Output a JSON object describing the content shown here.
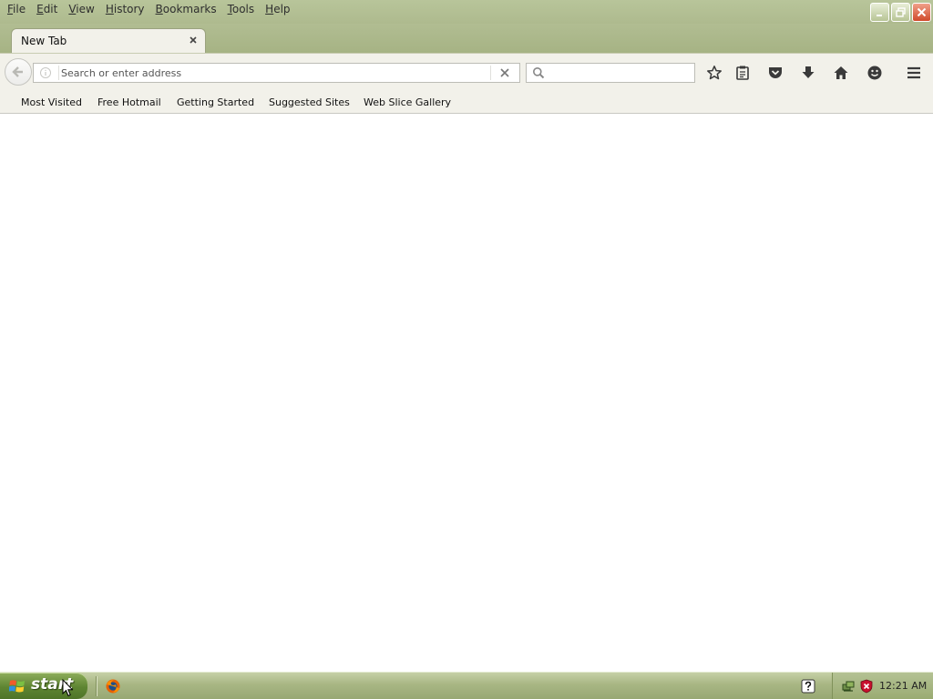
{
  "menu": {
    "items": [
      {
        "key": "F",
        "rest": "ile"
      },
      {
        "key": "E",
        "rest": "dit"
      },
      {
        "key": "V",
        "rest": "iew"
      },
      {
        "key": "H",
        "rest": "istory"
      },
      {
        "key": "B",
        "rest": "ookmarks"
      },
      {
        "key": "T",
        "rest": "ools"
      },
      {
        "key": "H",
        "rest": "elp"
      }
    ]
  },
  "tab": {
    "title": "New Tab"
  },
  "urlbar": {
    "placeholder": "Search or enter address",
    "value": ""
  },
  "searchbar": {
    "placeholder": "",
    "value": ""
  },
  "toolbar_icons": [
    "star-icon",
    "reading-list-icon",
    "pocket-icon",
    "download-icon",
    "home-icon",
    "smiley-icon",
    "menu-icon"
  ],
  "bookmarks": {
    "items": [
      {
        "label": "Most Visited"
      },
      {
        "label": "Free Hotmail"
      },
      {
        "label": "Getting Started"
      },
      {
        "label": "Suggested Sites"
      },
      {
        "label": "Web Slice Gallery"
      }
    ]
  },
  "taskbar": {
    "start_label": "start",
    "clock": "12:21 AM"
  },
  "colors": {
    "theme_olive": "#aeba8e",
    "toolbar_bg": "#f2f1ea",
    "close_red": "#d04a2b",
    "start_green": "#5e8532"
  }
}
